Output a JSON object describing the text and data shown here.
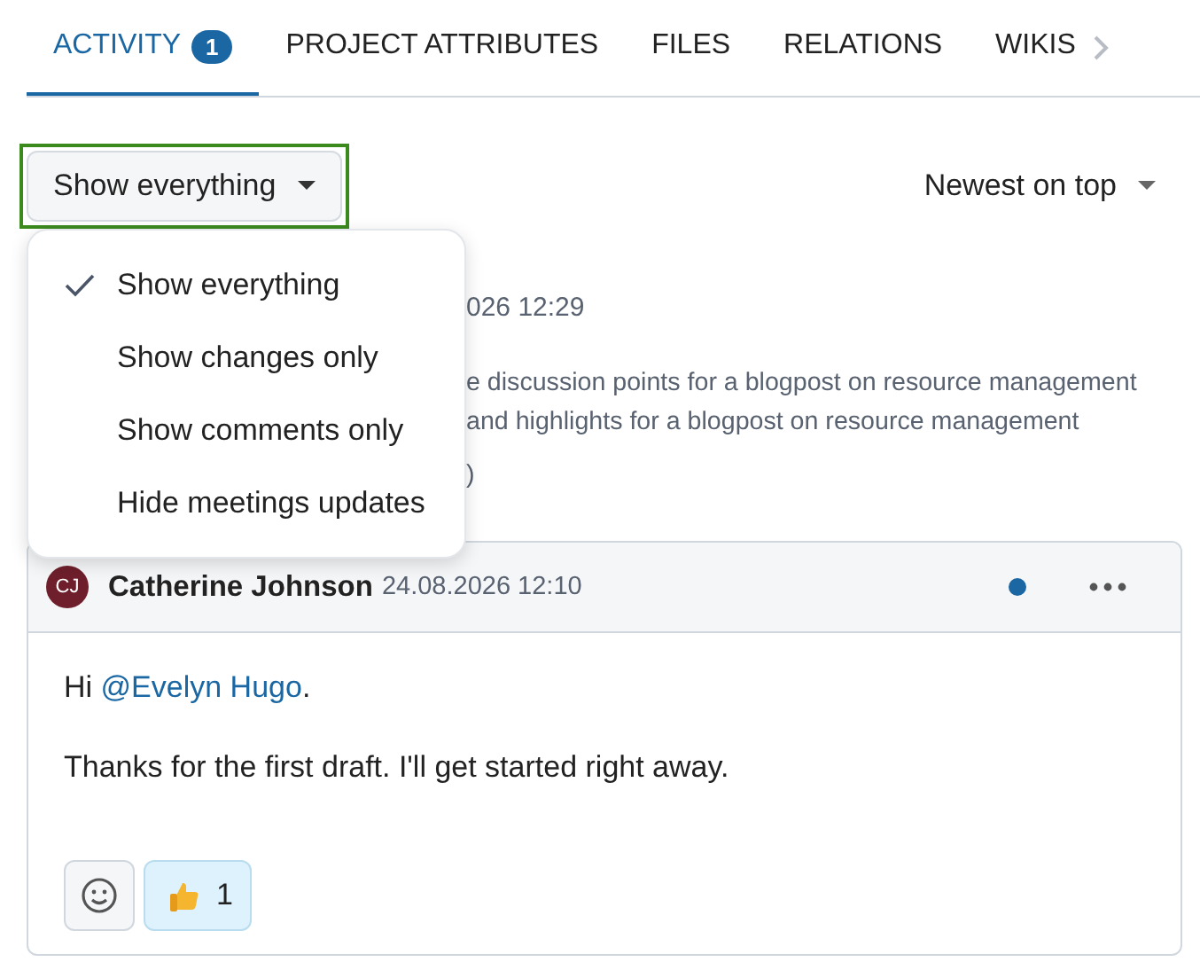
{
  "tabs": [
    {
      "label": "ACTIVITY",
      "badge": "1",
      "selected": true
    },
    {
      "label": "PROJECT ATTRIBUTES",
      "selected": false
    },
    {
      "label": "FILES",
      "selected": false
    },
    {
      "label": "RELATIONS",
      "selected": false
    },
    {
      "label": "WIKIS",
      "selected": false
    }
  ],
  "filter": {
    "label": "Show everything",
    "focused": true
  },
  "sort": {
    "label": "Newest on top"
  },
  "filter_menu": [
    {
      "label": "Show everything",
      "selected": true
    },
    {
      "label": "Show changes only",
      "selected": false
    },
    {
      "label": "Show comments only",
      "selected": false
    },
    {
      "label": "Hide meetings updates",
      "selected": false
    }
  ],
  "covered_entry": {
    "date": "026 12:29",
    "lines": [
      "e discussion points for a blogpost on resource management",
      "and highlights for a blogpost on resource management"
    ],
    "footer": ")"
  },
  "comment": {
    "initials": "CJ",
    "author": "Catherine Johnson",
    "date": "24.08.2026 12:10",
    "greeting": "Hi",
    "mention": "@Evelyn Hugo",
    "greeting_end": ".",
    "body": "Thanks for the first draft. I'll get started right away.",
    "unread": true,
    "reactions": [
      {
        "count": "1",
        "selected": true
      }
    ]
  }
}
